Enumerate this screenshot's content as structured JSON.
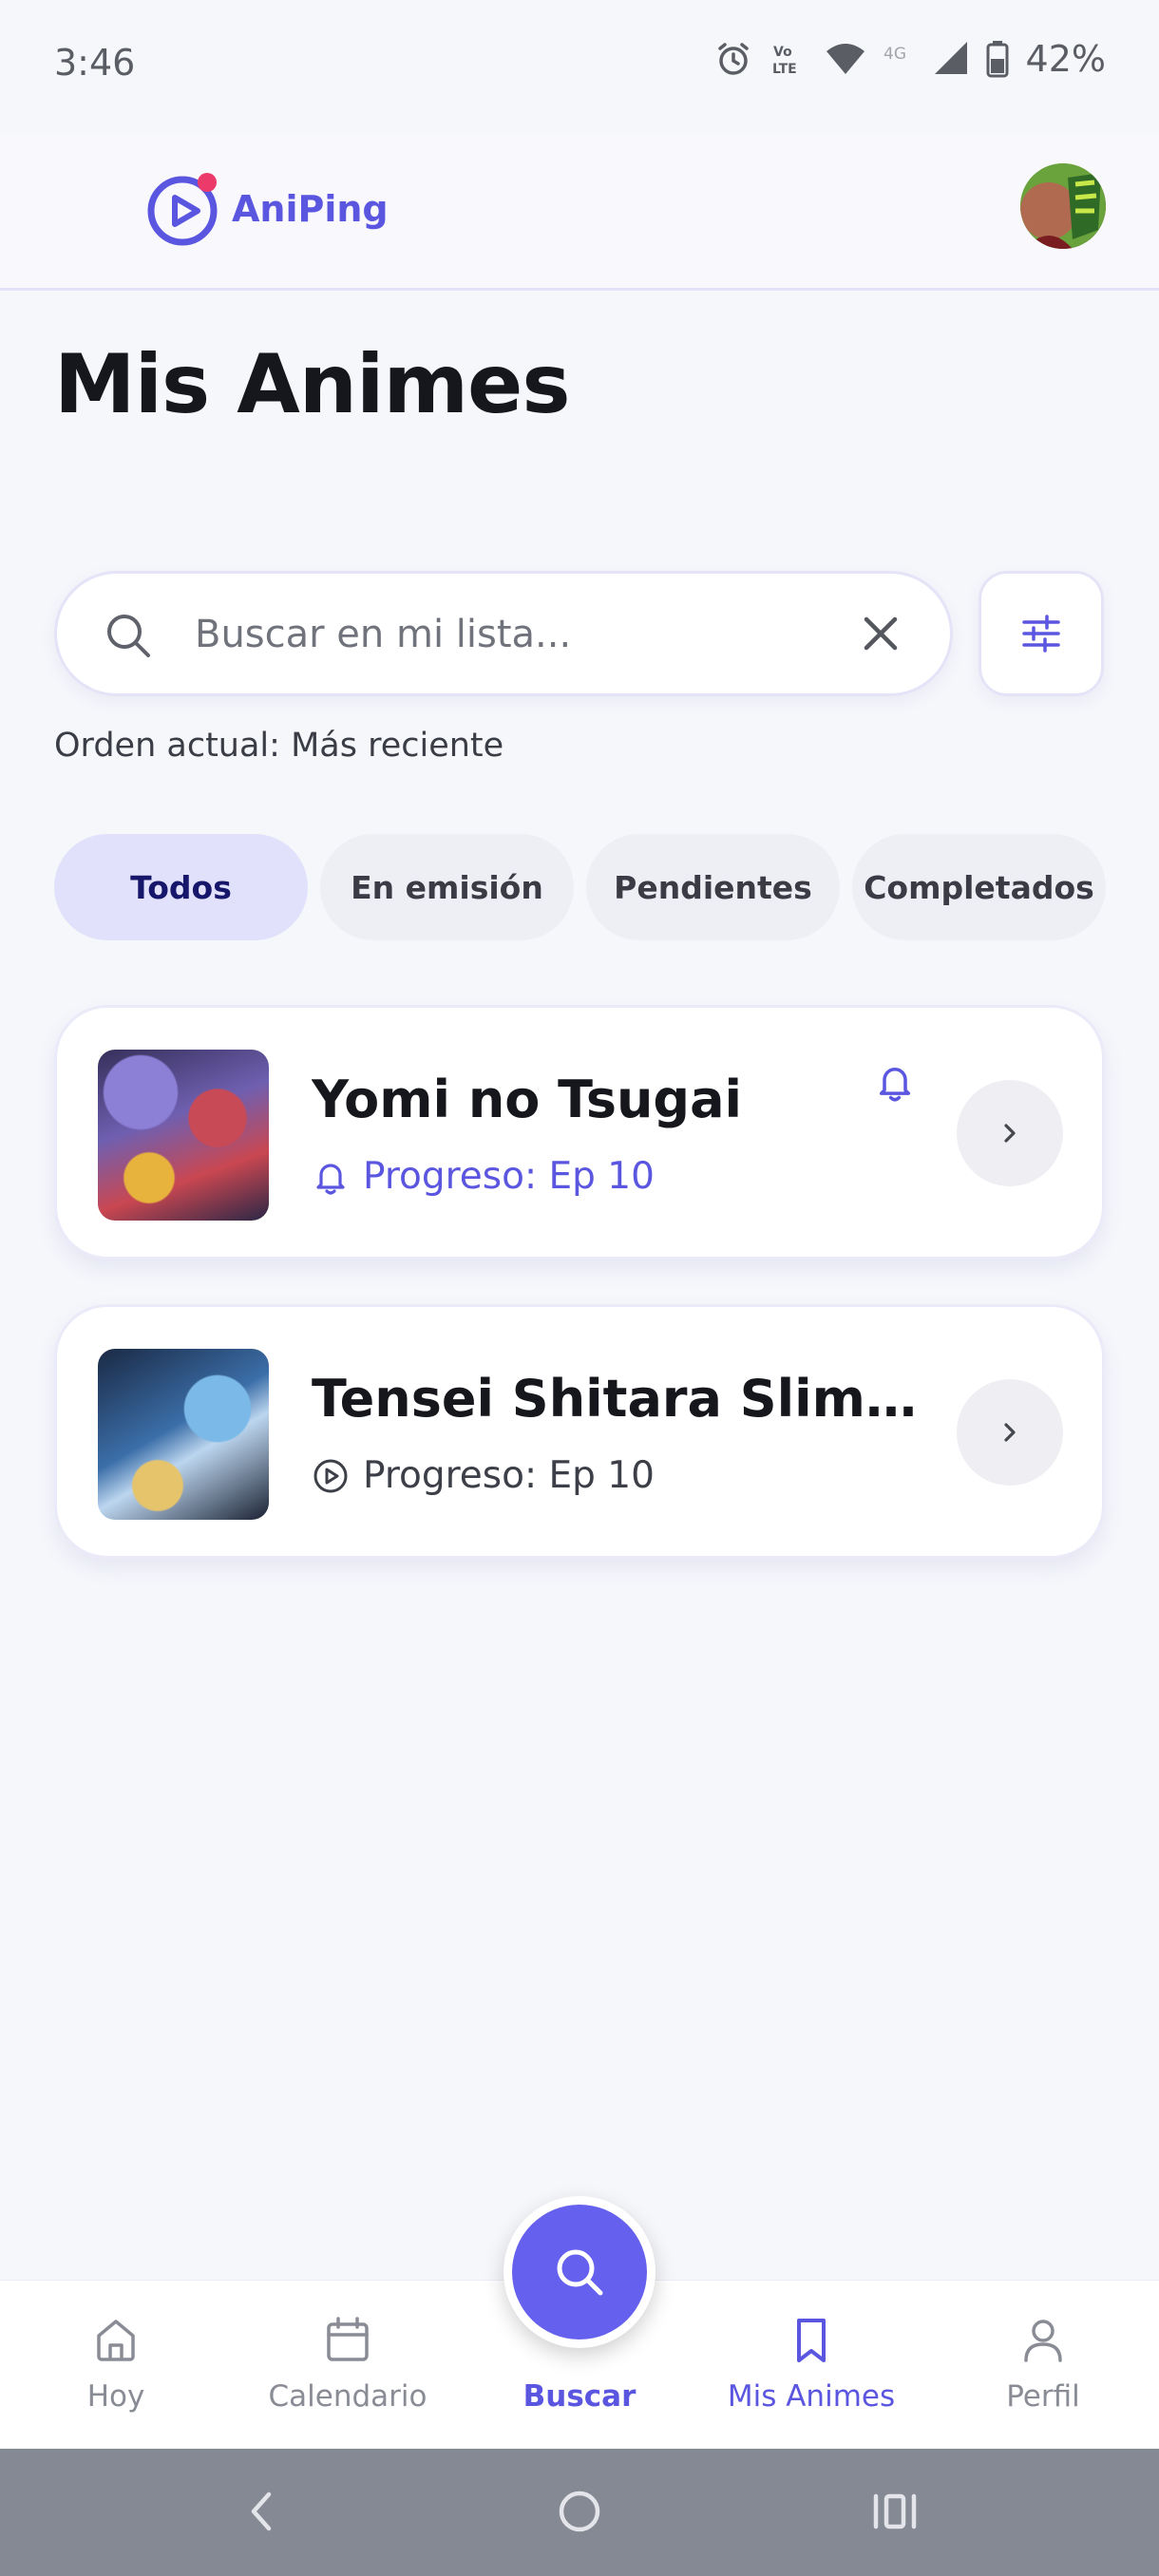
{
  "status_bar": {
    "time": "3:46",
    "battery": "42%"
  },
  "header": {
    "brand": "AniPing"
  },
  "page": {
    "title": "Mis Animes"
  },
  "search": {
    "placeholder": "Buscar en mi lista...",
    "value": ""
  },
  "sort": {
    "label": "Orden actual: Más reciente"
  },
  "filters": [
    {
      "label": "Todos",
      "active": true
    },
    {
      "label": "En emisión",
      "active": false
    },
    {
      "label": "Pendientes",
      "active": false
    },
    {
      "label": "Completados",
      "active": false
    }
  ],
  "anime_list": [
    {
      "title": "Yomi no Tsugai",
      "progress": "Progreso: Ep 10",
      "notifications": true
    },
    {
      "title": "Tensei Shitara Slime D...",
      "progress": "Progreso: Ep 10",
      "notifications": false
    }
  ],
  "bottom_nav": [
    {
      "label": "Hoy",
      "icon": "home-icon"
    },
    {
      "label": "Calendario",
      "icon": "calendar-icon"
    },
    {
      "label": "Buscar",
      "icon": "search-icon"
    },
    {
      "label": "Mis Animes",
      "icon": "bookmark-icon"
    },
    {
      "label": "Perfil",
      "icon": "person-icon"
    }
  ],
  "colors": {
    "accent": "#5b56e0",
    "fab": "#6560ee",
    "chip_active": "#e2e1fb",
    "background": "#f6f7fb"
  }
}
